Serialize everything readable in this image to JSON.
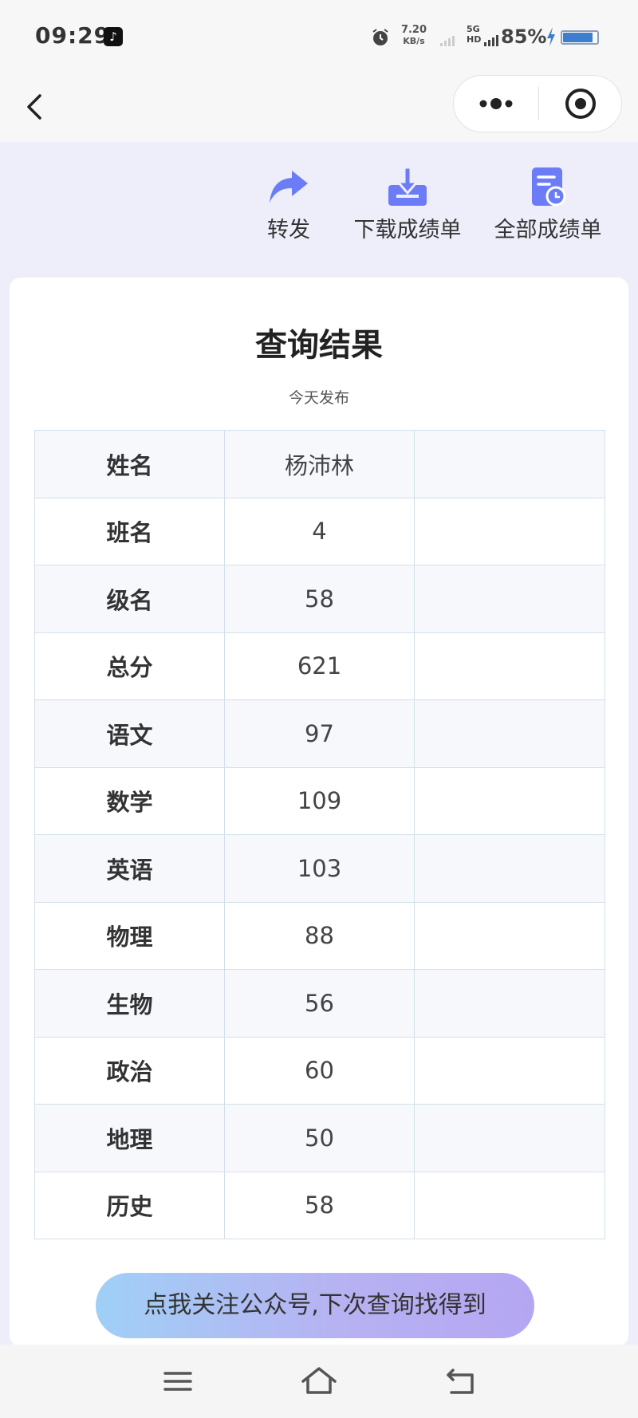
{
  "status_bar": {
    "time": "09:29",
    "app_icon": "tiktok-icon",
    "net_speed_value": "7.20",
    "net_speed_unit": "KB/s",
    "network_type_top": "5G HD",
    "battery": "85%"
  },
  "nav": {
    "back_icon": "chevron-left-icon",
    "more_icon": "more-dots-icon",
    "close_icon": "target-circle-icon"
  },
  "actions": [
    {
      "label": "转发",
      "icon": "share-arrow-icon"
    },
    {
      "label": "下载成绩单",
      "icon": "download-tray-icon"
    },
    {
      "label": "全部成绩单",
      "icon": "document-clock-icon"
    }
  ],
  "result": {
    "title": "查询结果",
    "subtitle": "今天发布"
  },
  "table": {
    "rows": [
      {
        "label": "姓名",
        "value": "杨沛林",
        "extra": ""
      },
      {
        "label": "班名",
        "value": "4",
        "extra": ""
      },
      {
        "label": "级名",
        "value": "58",
        "extra": ""
      },
      {
        "label": "总分",
        "value": "621",
        "extra": ""
      },
      {
        "label": "语文",
        "value": "97",
        "extra": ""
      },
      {
        "label": "数学",
        "value": "109",
        "extra": ""
      },
      {
        "label": "英语",
        "value": "103",
        "extra": ""
      },
      {
        "label": "物理",
        "value": "88",
        "extra": ""
      },
      {
        "label": "生物",
        "value": "56",
        "extra": ""
      },
      {
        "label": "政治",
        "value": "60",
        "extra": ""
      },
      {
        "label": "地理",
        "value": "50",
        "extra": ""
      },
      {
        "label": "历史",
        "value": "58",
        "extra": ""
      }
    ]
  },
  "follow_button": "点我关注公众号,下次查询找得到",
  "colors": {
    "accent": "#6b7cf6",
    "page_bg": "#eeeefb",
    "table_border": "#d3e0ea"
  },
  "system_nav": {
    "menu_icon": "menu-lines-icon",
    "home_icon": "home-icon",
    "back_icon": "system-back-icon"
  }
}
